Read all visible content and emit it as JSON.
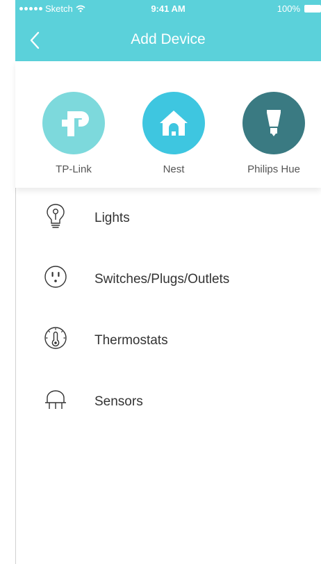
{
  "status_bar": {
    "carrier": "Sketch",
    "time": "9:41 AM",
    "battery": "100%"
  },
  "nav": {
    "title": "Add Device"
  },
  "brands": [
    {
      "label": "TP-Link",
      "icon": "tp-link-logo",
      "color": "#7dd9dc"
    },
    {
      "label": "Nest",
      "icon": "house-icon",
      "color": "#3ec6e0"
    },
    {
      "label": "Philips Hue",
      "icon": "bulb-icon",
      "color": "#3a7a82"
    }
  ],
  "categories": [
    {
      "label": "Lights",
      "icon": "lightbulb-icon"
    },
    {
      "label": "Switches/Plugs/Outlets",
      "icon": "outlet-icon"
    },
    {
      "label": "Thermostats",
      "icon": "thermostat-icon"
    },
    {
      "label": "Sensors",
      "icon": "sensor-icon"
    }
  ],
  "colors": {
    "header": "#5bd1da",
    "text": "#333333"
  }
}
